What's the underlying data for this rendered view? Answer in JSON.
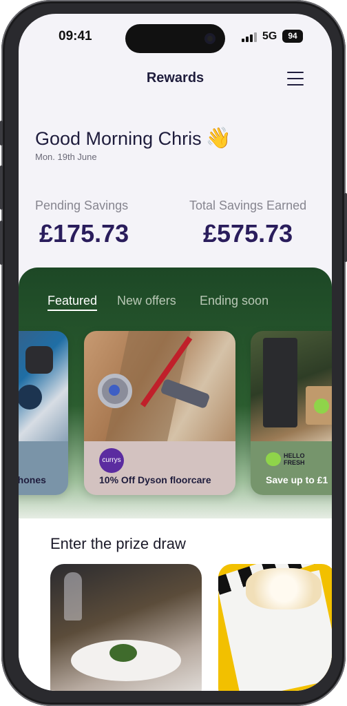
{
  "status_bar": {
    "time": "09:41",
    "network": "5G",
    "battery": "94"
  },
  "header": {
    "title": "Rewards",
    "menu_icon": "hamburger-icon"
  },
  "greeting": {
    "text": "Good Morning Chris",
    "emoji": "👋",
    "date": "Mon. 19th June"
  },
  "savings": {
    "pending_label": "Pending Savings",
    "pending_value": "£175.73",
    "total_label": "Total Savings Earned",
    "total_value": "£575.73"
  },
  "tabs": [
    {
      "label": "Featured",
      "active": true
    },
    {
      "label": "New offers",
      "active": false
    },
    {
      "label": "Ending soon",
      "active": false
    }
  ],
  "offers": [
    {
      "title": "rtphones",
      "brand": ""
    },
    {
      "title": "10% Off Dyson floorcare",
      "brand": "currys"
    },
    {
      "title": "Save up to £1",
      "brand": "HELLO FRESH"
    }
  ],
  "prize_draw": {
    "title": "Enter the prize draw"
  },
  "colors": {
    "accent": "#2a1d5c",
    "panel": "#1d4826"
  }
}
